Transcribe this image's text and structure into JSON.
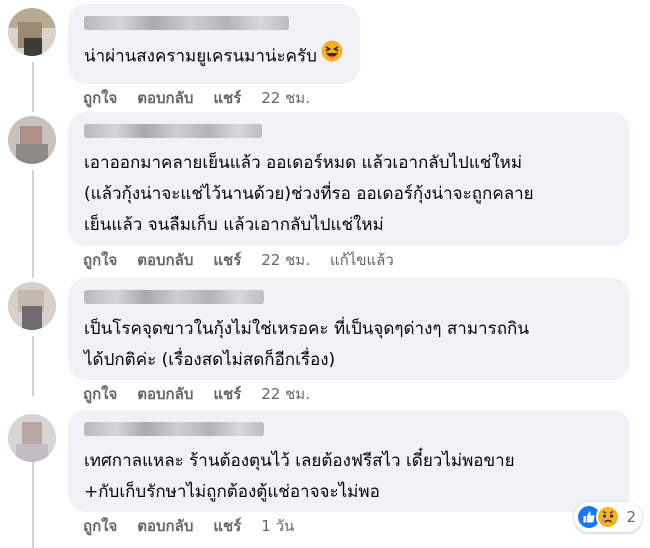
{
  "comments": [
    {
      "text": "น่าผ่านสงครามยูเครนมาน่ะครับ",
      "emoji": "laughing-emoji",
      "actions": {
        "like": "ถูกใจ",
        "reply": "ตอบกลับ",
        "share": "แชร์",
        "time": "22 ชม."
      }
    },
    {
      "text": "เอาออกมาคลายเย็นแล้ว ออเดอร์หมด แล้วเอากลับไปแช่ใหม่\n(แล้วกุ้งน่าจะแช่ไว้นานด้วย)ช่วงที่รอ ออเดอร์กุ้งน่าจะถูกคลาย\nเย็นแล้ว จนลืมเก็บ แล้วเอากลับไปแช่ใหม่",
      "actions": {
        "like": "ถูกใจ",
        "reply": "ตอบกลับ",
        "share": "แชร์",
        "time": "22 ชม.",
        "edited": "แก้ไขแล้ว"
      }
    },
    {
      "text": "เป็นโรคจุดขาวในกุ้งไม่ใช่เหรอคะ ที่เป็นจุดๆด่างๆ สามารถกิน\nได้ปกติค่ะ (เรื่องสดไม่สดก็อีกเรื่อง)",
      "actions": {
        "like": "ถูกใจ",
        "reply": "ตอบกลับ",
        "share": "แชร์",
        "time": "22 ชม."
      }
    },
    {
      "text": "เทศกาลแหละ ร้านต้องตุนไว้ เลยต้องฟรีสไว เดี๋ยวไม่พอขาย\n+กับเก็บรักษาไม่ถูกต้องตู้แช่อาจจะไม่พอ",
      "actions": {
        "like": "ถูกใจ",
        "reply": "ตอบกลับ",
        "share": "แชร์",
        "time": "1 วัน"
      },
      "reactions": {
        "icons": [
          "like-icon",
          "sad-icon"
        ],
        "count": "2",
        "like_color": "#1877f2",
        "sad_color": "#f7b125"
      }
    }
  ]
}
